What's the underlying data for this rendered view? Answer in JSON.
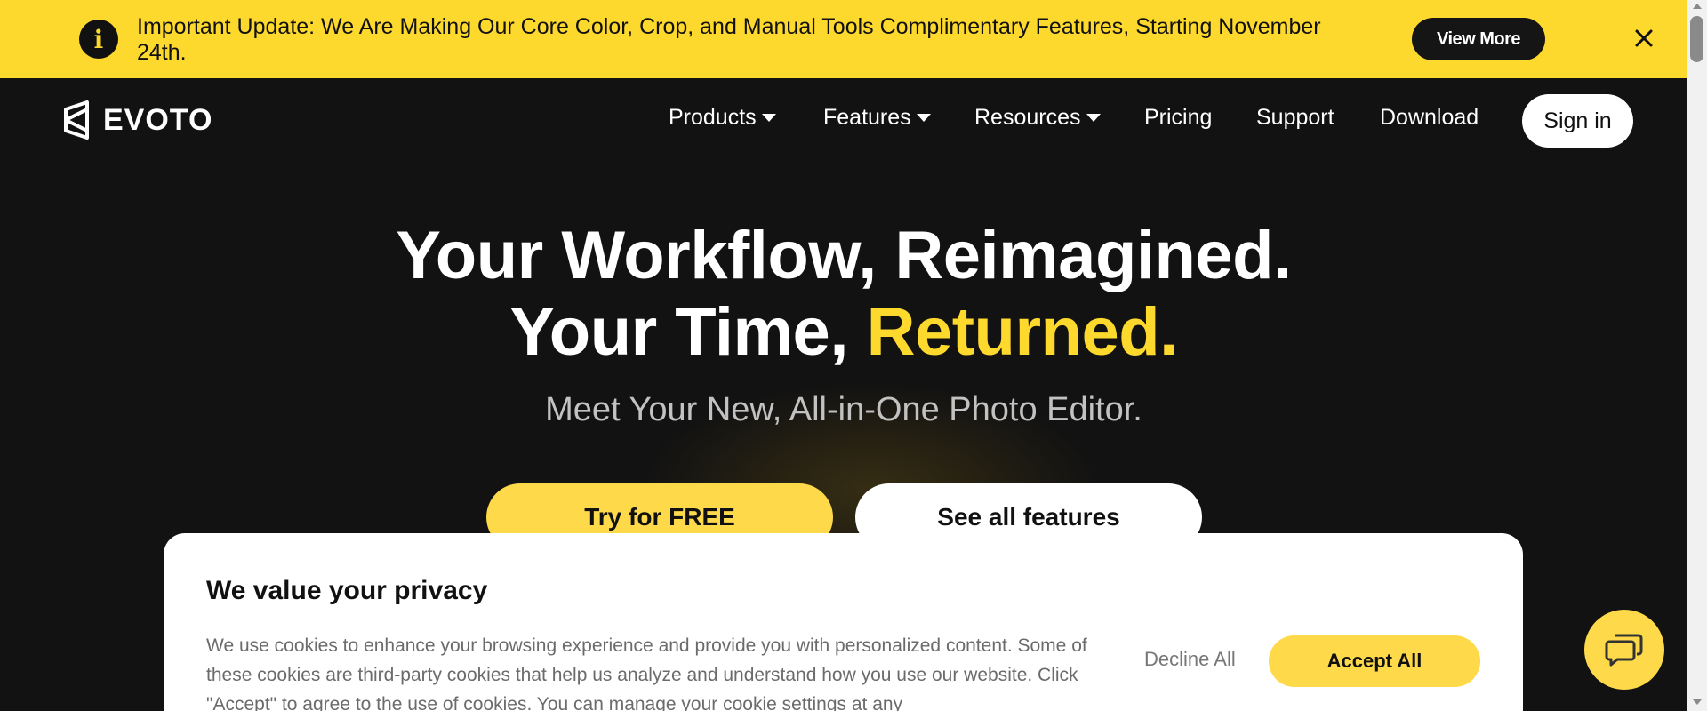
{
  "banner": {
    "icon": "info-icon",
    "text": "Important Update: We Are Making Our Core Color, Crop, and Manual Tools Complimentary Features, Starting November 24th.",
    "button_label": "View More",
    "close_icon": "close-icon",
    "background": "#fed92d"
  },
  "header": {
    "logo_text": "EVOTO",
    "nav": [
      {
        "label": "Products",
        "has_dropdown": true
      },
      {
        "label": "Features",
        "has_dropdown": true
      },
      {
        "label": "Resources",
        "has_dropdown": true
      },
      {
        "label": "Pricing",
        "has_dropdown": false
      },
      {
        "label": "Support",
        "has_dropdown": false
      },
      {
        "label": "Download",
        "has_dropdown": false
      }
    ],
    "signin_label": "Sign in"
  },
  "hero": {
    "line1": "Your Workflow, Reimagined.",
    "line2_prefix": "Your Time, ",
    "line2_accent": "Returned.",
    "subtitle": "Meet Your New, All-in-One Photo Editor.",
    "cta_primary": "Try for FREE",
    "cta_secondary": "See all features",
    "accent_color": "#fed92d"
  },
  "cookie": {
    "title": "We value your privacy",
    "text": "We use cookies to enhance your browsing experience and provide you with personalized content. Some of these cookies are third-party cookies that help us analyze and understand how you use our website. Click \"Accept\" to agree to the use of cookies. You can manage your cookie settings at any",
    "decline_label": "Decline All",
    "accept_label": "Accept All"
  },
  "chat": {
    "icon": "chat-bubbles-icon"
  },
  "colors": {
    "background": "#121212",
    "accent": "#fed94a"
  }
}
